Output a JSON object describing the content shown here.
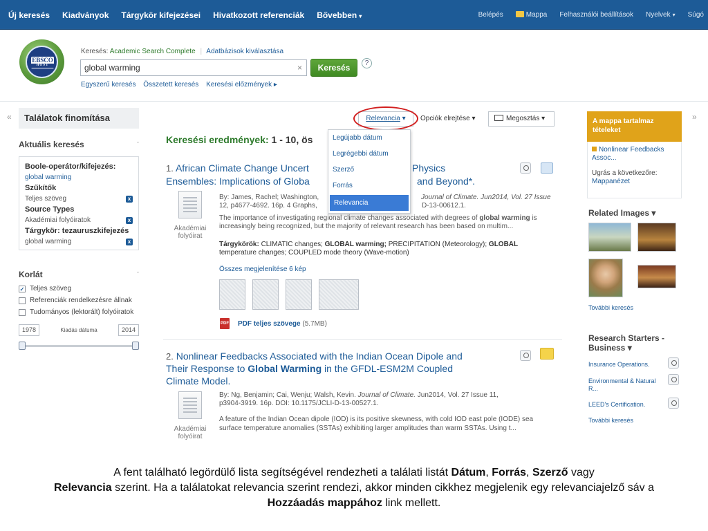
{
  "nav": {
    "left": [
      "Új keresés",
      "Kiadványok",
      "Tárgykör kifejezései",
      "Hivatkozott referenciák",
      "Bővebben"
    ],
    "more_caret": "▾",
    "right": [
      "Belépés",
      "Mappa",
      "Felhasználói beállítások",
      "Nyelvek",
      "Súgó"
    ]
  },
  "logo": {
    "brand": "EBSCO",
    "host": "HOST"
  },
  "search": {
    "db_prefix": "Keresés:",
    "db_name": "Academic Search Complete",
    "db_choose": "Adatbázisok kiválasztása",
    "query": "global warming",
    "button": "Keresés",
    "help": "?",
    "links": [
      "Egyszerű keresés",
      "Összetett keresés",
      "Keresési előzmények ▸"
    ]
  },
  "left": {
    "panel_title": "Találatok finomítása",
    "current_title": "Aktuális keresés",
    "boole_label": "Boole-operátor/kifejezés:",
    "boole_value": "global warming",
    "limiters_label": "Szűkítők",
    "limiter_value": "Teljes szöveg",
    "source_types_label": "Source Types",
    "source_type_value": "Akadémiai folyóiratok",
    "subject_label": "Tárgykör: tezauruszkifejezés",
    "subject_value": "global warming",
    "limit_title": "Korlát",
    "limit_options": [
      {
        "label": "Teljes szöveg",
        "checked": true
      },
      {
        "label": "Referenciák rendelkezésre állnak",
        "checked": false
      },
      {
        "label": "Tudományos (lektorált) folyóiratok",
        "checked": false
      }
    ],
    "date_from": "1978",
    "date_label": "Kiadás dátuma",
    "date_to": "2014"
  },
  "toolbar": {
    "sort_label": "Relevancia",
    "options_label": "Opciók elrejtése",
    "share_label": "Megosztás",
    "sort_options": [
      "Legújabb dátum",
      "Legrégebbi dátum",
      "Szerző",
      "Forrás",
      "Relevancia"
    ]
  },
  "results": {
    "title_prefix": "Keresési eredmények:",
    "title_range": "1 - 10, ös",
    "items": [
      {
        "num": "1.",
        "title_a": "African Climate Change Uncert",
        "title_b": "Physics",
        "title_c": "Ensembles: Implications of Globa",
        "title_d": "and Beyond*.",
        "meta_a": "By: James, Rachel; Washington,",
        "meta_b": "Journal of Climate. Jun2014, Vol. 27 Issue",
        "meta_c": "12, p4677-4692. 16p. 4 Graphs,",
        "meta_d": "D-13-00612.1.",
        "abs_a": "The importance of investigating regional climate changes associated with degrees of",
        "abs_strong": "global warming",
        "abs_b": "is increasingly being recognized, but the majority of relevant research has been based on multim...",
        "subj_label": "Tárgykörök:",
        "subj_text_a": "CLIMATIC changes;",
        "subj_strong_a": "GLOBAL warming;",
        "subj_text_b": "PRECIPITATION (Meteorology);",
        "subj_strong_b": "GLOBAL",
        "subj_text_c": "temperature changes; COUPLED mode theory (Wave-motion)",
        "type_label": "Akadémiai folyóirat",
        "show_images": "Összes megjelenítése 6 kép",
        "pdf_label": "PDF teljes szövege",
        "pdf_size": "(5.7MB)"
      },
      {
        "num": "2.",
        "title_line1": "Nonlinear Feedbacks Associated with the Indian Ocean Dipole and",
        "title_line2_a": "Their Response to",
        "title_line2_strong": "Global Warming",
        "title_line2_b": "in the GFDL-ESM2M Coupled",
        "title_line3": "Climate Model.",
        "meta_a": "By: Ng, Benjamin; Cai, Wenju; Walsh, Kevin.",
        "meta_journal": "Journal of Climate.",
        "meta_b": "Jun2014, Vol. 27 Issue 11,",
        "meta_c": "p3904-3919. 16p. DOI: 10.1175/JCLI-D-13-00527.1.",
        "abs_a": "A feature of the Indian Ocean dipole (IOD) is its positive skewness, with cold IOD east pole (IODE) sea",
        "abs_b": "surface temperature anomalies (SSTAs) exhibiting larger amplitudes than warm SSTAs. Using t...",
        "type_label": "Akadémiai folyóirat"
      }
    ]
  },
  "right": {
    "folder_title": "A mappa tartalmaz tételeket",
    "folder_item": "Nonlinear Feedbacks Assoc...",
    "goto_label": "Ugrás a következőre:",
    "goto_link": "Mappanézet",
    "related_title": "Related Images",
    "related_more": "További keresés",
    "rs_title": "Research Starters - Business",
    "rs_items": [
      "Insurance Operations.",
      "Environmental & Natural R...",
      "LEED's Certification."
    ],
    "rs_more": "További keresés"
  },
  "caption": {
    "p1": "A fent található legördülő lista segítségével rendezheti a találati listát",
    "b1": "Dátum",
    "s1": ",",
    "b2": "Forrás",
    "s2": ",",
    "b3": "Szerző",
    "p2": "vagy",
    "b4": "Relevancia",
    "p3": "szerint. Ha a találatokat relevancia szerint rendezi, akkor minden cikkhez megjelenik egy relevanciajelző sáv a",
    "b5": "Hozzáadás mappához",
    "p4": "link mellett."
  },
  "colors": {
    "nav": "#1d5b97",
    "accent_green": "#2d7a2b",
    "folder": "#e0a31a",
    "highlight_red": "#d21e1e"
  }
}
